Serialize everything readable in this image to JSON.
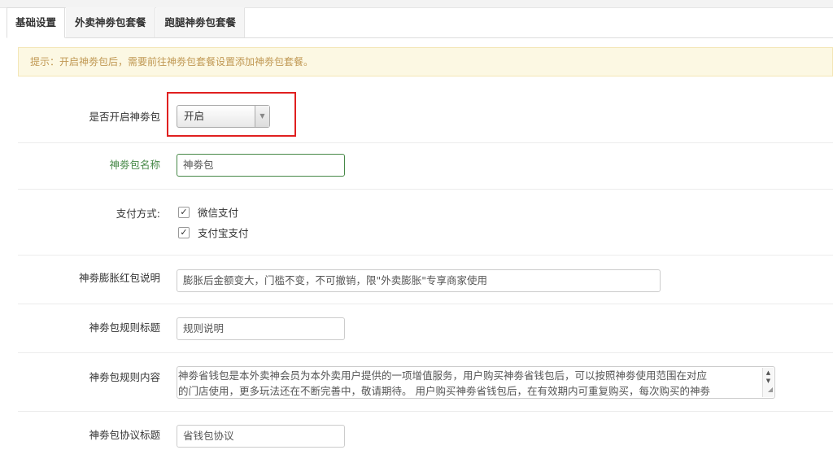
{
  "tabs": [
    {
      "label": "基础设置",
      "active": true
    },
    {
      "label": "外卖神劵包套餐",
      "active": false
    },
    {
      "label": "跑腿神劵包套餐",
      "active": false
    }
  ],
  "notice": "提示：开启神劵包后，需要前往神劵包套餐设置添加神劵包套餐。",
  "form": {
    "enable": {
      "label": "是否开启神劵包",
      "value": "开启"
    },
    "name": {
      "label": "神劵包名称",
      "value": "神劵包"
    },
    "payment": {
      "label": "支付方式:",
      "options": [
        {
          "label": "微信支付",
          "checked": true
        },
        {
          "label": "支付宝支付",
          "checked": true
        }
      ]
    },
    "redpacket_desc": {
      "label": "神劵膨胀红包说明",
      "value": "膨胀后金额变大，门槛不变，不可撤销，限\"外卖膨胀\"专享商家使用"
    },
    "rule_title": {
      "label": "神劵包规则标题",
      "value": "规则说明"
    },
    "rule_content": {
      "label": "神劵包规则内容",
      "line1": "神劵省钱包是本外卖神会员为本外卖用户提供的一项增值服务，用户购买神劵省钱包后，可以按照神劵使用范围在对应",
      "line2": "的门店使用，更多玩法还在不断完善中，敬请期待。 用户购买神劵省钱包后，在有效期内可重复购买，每次购买的神劵"
    },
    "agreement_title": {
      "label": "神劵包协议标题",
      "value": "省钱包协议"
    }
  },
  "icons": {
    "check": "✓",
    "select_arrow": "▼",
    "scroll_up": "▲",
    "scroll_down": "▼",
    "resize_grip": "◢"
  },
  "colors": {
    "notice_bg": "#fcf8e3",
    "notice_text": "#c09853",
    "success": "#468847",
    "highlight": "#e02020"
  }
}
